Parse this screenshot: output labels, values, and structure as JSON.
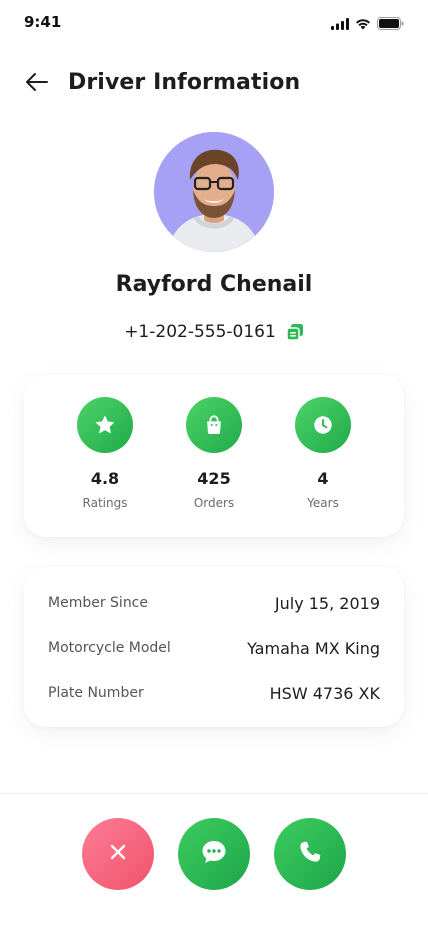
{
  "status_bar": {
    "time": "9:41",
    "icons": [
      "cellular-signal-icon",
      "wifi-icon",
      "battery-icon"
    ]
  },
  "header": {
    "title": "Driver Information",
    "back_icon": "arrow-left-icon"
  },
  "driver": {
    "name": "Rayford Chenail",
    "phone": "+1-202-555-0161",
    "copy_icon": "copy-icon",
    "avatar_bg": "#a7a1f5"
  },
  "stats": [
    {
      "icon": "star-icon",
      "value": "4.8",
      "label": "Ratings"
    },
    {
      "icon": "shopping-bag-icon",
      "value": "425",
      "label": "Orders"
    },
    {
      "icon": "clock-icon",
      "value": "4",
      "label": "Years"
    }
  ],
  "info": [
    {
      "label": "Member Since",
      "value": "July 15, 2019"
    },
    {
      "label": "Motorcycle Model",
      "value": "Yamaha MX King"
    },
    {
      "label": "Plate Number",
      "value": "HSW 4736 XK"
    }
  ],
  "actions": [
    {
      "name": "cancel",
      "icon": "close-icon",
      "color": "#f5607a"
    },
    {
      "name": "chat",
      "icon": "chat-bubble-icon",
      "color": "#2bb955"
    },
    {
      "name": "call",
      "icon": "phone-icon",
      "color": "#2bb955"
    }
  ],
  "colors": {
    "accent_green": "#2bb955",
    "danger_pink": "#f5607a",
    "text_primary": "#1d1d1d",
    "text_secondary": "#6b6b6b"
  }
}
